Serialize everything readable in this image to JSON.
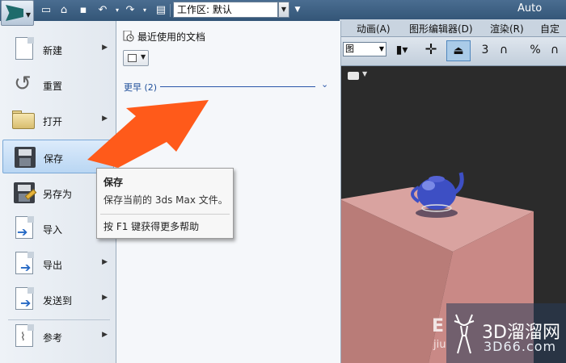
{
  "app": {
    "title": "Auto",
    "workspace_label": "工作区: 默认"
  },
  "menu_bar": {
    "items": [
      "动画(A)",
      "图形编辑器(D)",
      "渲染(R)",
      "自定义"
    ]
  },
  "ribbon": {
    "view_select_value": "图",
    "snap_label": "3",
    "percent_label": "%"
  },
  "app_menu": {
    "items": [
      {
        "label": "新建",
        "has_submenu": true,
        "icon": "new-document-icon"
      },
      {
        "label": "重置",
        "has_submenu": false,
        "icon": "reset-icon"
      },
      {
        "label": "打开",
        "has_submenu": true,
        "icon": "open-folder-icon"
      },
      {
        "label": "保存",
        "has_submenu": false,
        "icon": "save-icon",
        "highlighted": true
      },
      {
        "label": "另存为",
        "has_submenu": true,
        "icon": "save-as-icon"
      },
      {
        "label": "导入",
        "has_submenu": false,
        "icon": "import-icon"
      },
      {
        "label": "导出",
        "has_submenu": true,
        "icon": "export-icon"
      },
      {
        "label": "发送到",
        "has_submenu": true,
        "icon": "send-to-icon"
      },
      {
        "label": "参考",
        "has_submenu": true,
        "icon": "reference-icon"
      }
    ],
    "recent": {
      "title": "最近使用的文档",
      "group_label": "更早 (2)"
    }
  },
  "tooltip": {
    "title": "保存",
    "description": "保存当前的 3ds Max 文件。",
    "help": "按 F1 键获得更多帮助"
  },
  "watermark": {
    "name": "3D溜溜网",
    "url": "3D66.com",
    "left_fragment": "E",
    "left_sub": "jiu"
  },
  "colors": {
    "title_bar": "#3d5f82",
    "highlight": "#b9d6f3",
    "annotation_arrow": "#ff5a1a",
    "box": "#c98986",
    "teapot": "#3d4fc4"
  }
}
